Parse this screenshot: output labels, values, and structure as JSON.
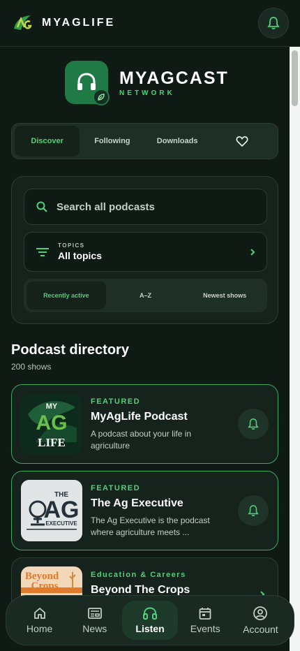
{
  "appbar": {
    "brand_name": "MYAGLIFE",
    "notifications_icon": "bell-icon"
  },
  "hero": {
    "title": "MYAGCAST",
    "subtitle": "NETWORK",
    "icon": "headphones-icon"
  },
  "tabs": [
    {
      "label": "Discover",
      "active": true
    },
    {
      "label": "Following",
      "active": false
    },
    {
      "label": "Downloads",
      "active": false
    },
    {
      "label": "",
      "icon": "heart-icon",
      "active": false
    }
  ],
  "search": {
    "placeholder": "Search all podcasts"
  },
  "topics": {
    "label": "TOPICS",
    "value": "All topics"
  },
  "sort": [
    {
      "label": "Recently active",
      "active": true
    },
    {
      "label": "A–Z",
      "active": false
    },
    {
      "label": "Newest shows",
      "active": false
    }
  ],
  "directory": {
    "title": "Podcast directory",
    "count": "200 shows",
    "items": [
      {
        "tag": "FEATURED",
        "title": "MyAgLife Podcast",
        "description": "A podcast about your life in agriculture"
      },
      {
        "tag": "FEATURED",
        "title": "The Ag Executive",
        "description": "The Ag Executive is the podcast where agriculture meets ..."
      },
      {
        "tag": "Education & Careers",
        "title": "Beyond The Crops",
        "description": ""
      }
    ]
  },
  "bottom_nav": [
    {
      "label": "Home",
      "icon": "home-icon",
      "active": false
    },
    {
      "label": "News",
      "icon": "news-icon",
      "active": false
    },
    {
      "label": "Listen",
      "icon": "headphones-icon",
      "active": true
    },
    {
      "label": "Events",
      "icon": "calendar-icon",
      "active": false
    },
    {
      "label": "Account",
      "icon": "account-icon",
      "active": false
    }
  ],
  "colors": {
    "background": "#0f1a15",
    "accent": "#4fd07a",
    "card": "#15231c",
    "brand_green": "#1f7a45"
  }
}
